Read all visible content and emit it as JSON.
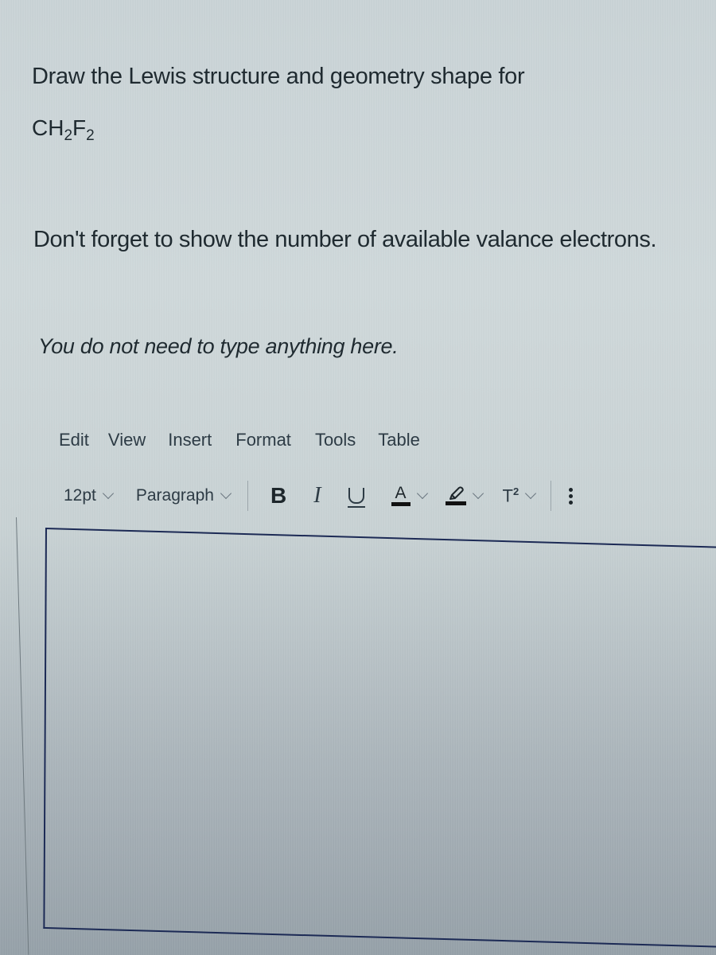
{
  "question": {
    "line1": "Draw the Lewis structure and geometry shape for",
    "formula": {
      "parts": [
        "CH",
        "2",
        "F",
        "2"
      ],
      "plain": "CH2F2"
    },
    "line2": "Don't forget to show the number of available valance electrons.",
    "line3": "You do not need to type anything here."
  },
  "editor": {
    "menubar": [
      "Edit",
      "View",
      "Insert",
      "Format",
      "Tools",
      "Table"
    ],
    "toolbar": {
      "font_size": "12pt",
      "block_format": "Paragraph",
      "bold_label": "B",
      "italic_label": "I",
      "text_color_label": "A",
      "superscript_label": "T",
      "superscript_exponent": "2",
      "icons": {
        "bold": "bold-icon",
        "italic": "italic-icon",
        "underline": "underline-icon",
        "text_color": "text-color-icon",
        "highlight": "highlight-icon",
        "superscript": "superscript-icon",
        "more": "more-vertical-icon"
      }
    },
    "content": ""
  },
  "colors": {
    "editor_border": "#1c2a55",
    "text": "#2d3b45"
  }
}
